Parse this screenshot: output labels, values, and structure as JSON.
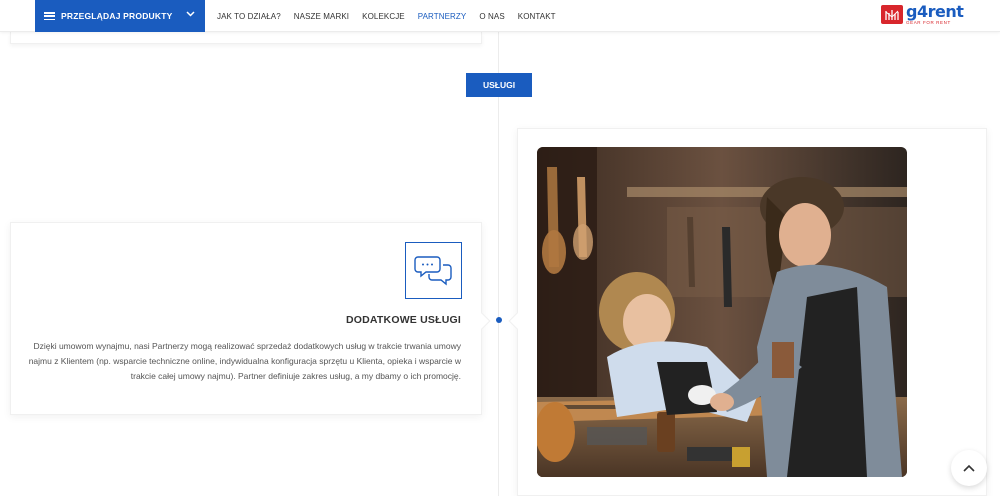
{
  "header": {
    "browse_label": "PRZEGLĄDAJ PRODUKTY",
    "nav": [
      {
        "label": "JAK TO DZIAŁA?",
        "active": false
      },
      {
        "label": "NASZE MARKI",
        "active": false
      },
      {
        "label": "KOLEKCJE",
        "active": false
      },
      {
        "label": "PARTNERZY",
        "active": true
      },
      {
        "label": "O NAS",
        "active": false
      },
      {
        "label": "KONTAKT",
        "active": false
      }
    ],
    "logo": {
      "brand": "g4rent",
      "tagline": "GEAR FOR RENT"
    }
  },
  "section": {
    "tag_label": "USŁUGI"
  },
  "feature": {
    "icon": "chat-bubbles-icon",
    "title": "DODATKOWE USŁUGI",
    "description": "Dzięki umowom wynajmu, nasi Partnerzy mogą realizować sprzedaż dodatkowych usług w trakcie trwania umowy najmu z Klientem (np. wsparcie techniczne online, indywidualna konfiguracja sprzętu u Klienta, opieka i wsparcie w trakcie całej umowy najmu). Partner definiuje zakres usług, a my dbamy o ich promocję."
  },
  "image": {
    "icon": "photo-two-men-guitar-workshop"
  },
  "colors": {
    "accent": "#1a5cbf",
    "logo_red": "#d8262c"
  },
  "scroll_top_icon": "chevron-up-icon"
}
